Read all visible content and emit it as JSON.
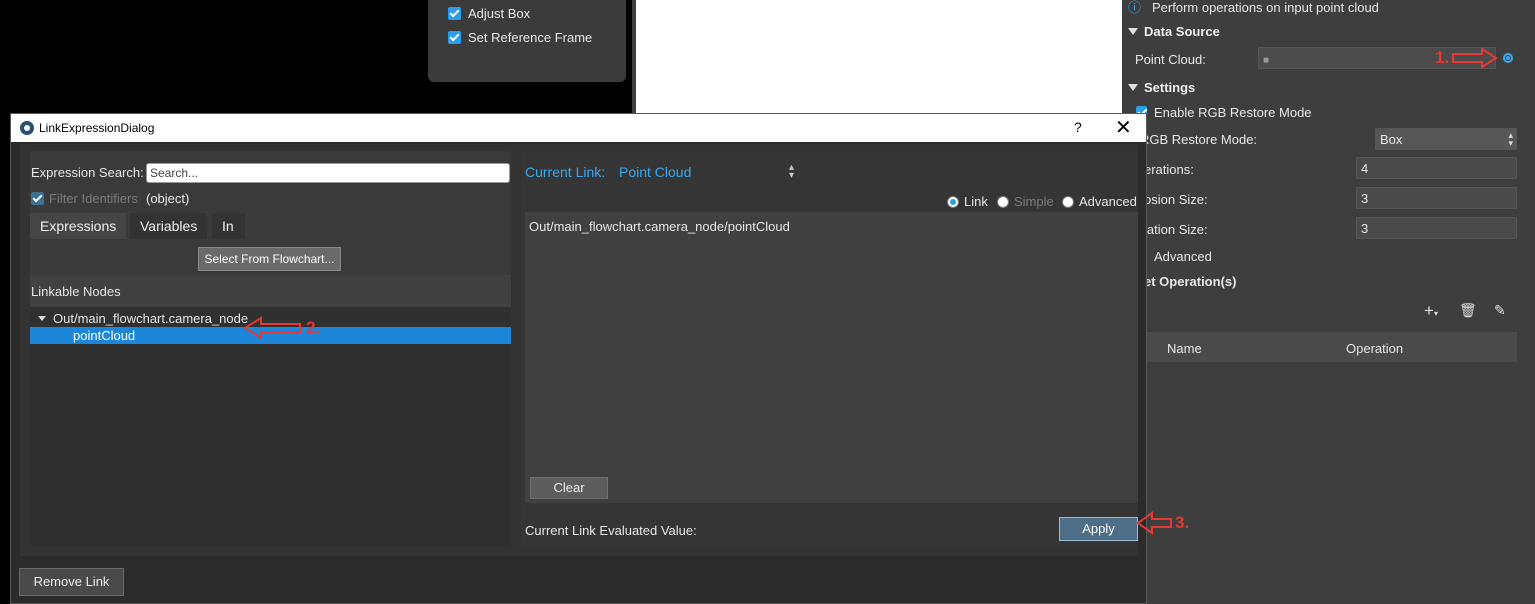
{
  "background_popup": {
    "items": [
      {
        "label": "Adjust Box",
        "checked": true
      },
      {
        "label": "Set Reference Frame",
        "checked": true
      }
    ]
  },
  "right_panel": {
    "description": "Perform operations on input point cloud",
    "data_source": {
      "title": "Data Source",
      "point_cloud_label": "Point Cloud:"
    },
    "settings": {
      "title": "Settings",
      "enable_rgb_label": "Enable RGB Restore Mode",
      "rgb_mode_label": "RGB Restore Mode:",
      "rgb_mode_value": "Box",
      "iterations_label": "erations:",
      "iterations_value": "4",
      "erosion_label": "osion Size:",
      "erosion_value": "3",
      "dilation_label": "lation Size:",
      "dilation_value": "3",
      "advanced_label": "Advanced",
      "set_operations_label": "et Operation(s)"
    },
    "table": {
      "columns": [
        "Name",
        "Operation"
      ]
    }
  },
  "dialog": {
    "title": "LinkExpressionDialog",
    "help": "?",
    "close": "✕",
    "left": {
      "search_label": "Expression Search:",
      "search_placeholder": "Search...",
      "filter_label": "Filter Identifiers",
      "filter_value": "(object)",
      "tabs": [
        "Expressions",
        "Variables",
        "In"
      ],
      "select_button": "Select From Flowchart...",
      "linkable_header": "Linkable Nodes",
      "tree_parent": "Out/main_flowchart.camera_node",
      "tree_child": "pointCloud"
    },
    "right": {
      "current_link_label": "Current Link:",
      "current_link_value": "Point Cloud",
      "modes": [
        {
          "label": "Link",
          "selected": true
        },
        {
          "label": "Simple",
          "selected": false
        },
        {
          "label": "Advanced",
          "selected": false
        }
      ],
      "expression": "Out/main_flowchart.camera_node/pointCloud",
      "clear_button": "Clear",
      "evaluated_label": "Current Link Evaluated Value:",
      "apply_button": "Apply"
    },
    "remove_link_button": "Remove Link"
  },
  "annotations": {
    "step1": "1.",
    "step2": "2.",
    "step3": "3.",
    "color": "#e53935"
  }
}
